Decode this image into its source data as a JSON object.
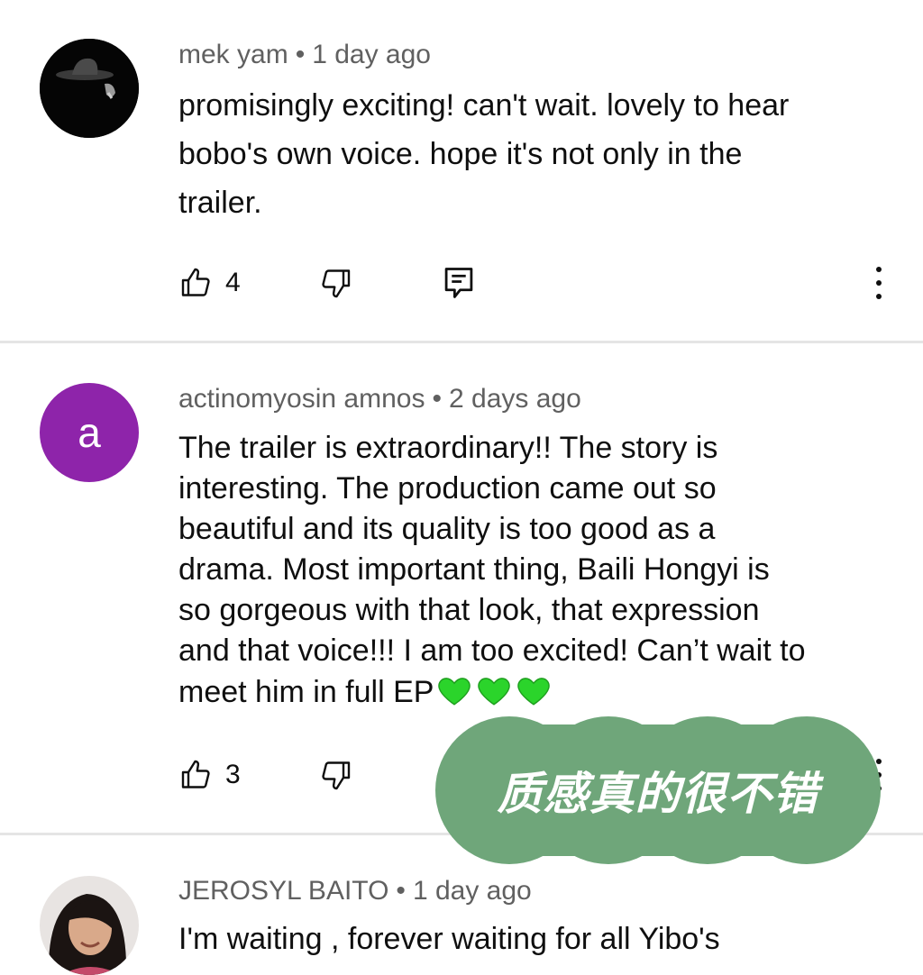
{
  "comments": [
    {
      "author": "mek yam",
      "separator": "•",
      "time": "1 day ago",
      "lines": [
        "promisingly exciting! can't wait. lovely to hear",
        "bobo's own voice. hope it's not only in the",
        "trailer."
      ],
      "likes": "4",
      "avatar": {
        "type": "photo",
        "description_icon": "hat-avatar-icon"
      }
    },
    {
      "author": "actinomyosin amnos",
      "separator": "•",
      "time": "2 days ago",
      "lines": [
        "The trailer is extraordinary!! The story is",
        "interesting. The production came out so",
        "beautiful and its quality is too good as a",
        "drama. Most important thing, Baili Hongyi is",
        "so gorgeous with that look, that expression",
        "and that voice!!! I am too excited! Can’t wait to",
        "meet him in full EP"
      ],
      "likes": "3",
      "avatar": {
        "type": "letter",
        "letter": "a",
        "color": "#8e24aa"
      }
    },
    {
      "author": "JEROSYL BAITO",
      "separator": "•",
      "time": "1 day ago",
      "lines": [
        "I'm waiting , forever waiting for all Yibo's"
      ],
      "avatar": {
        "type": "photo"
      }
    }
  ],
  "overlay": {
    "text": "质感真的很不错",
    "color": "#6fa67a"
  },
  "colors": {
    "meta": "#606060",
    "text": "#0f0f0f",
    "divider": "#e5e5e5",
    "heart": "#2bd42b"
  }
}
